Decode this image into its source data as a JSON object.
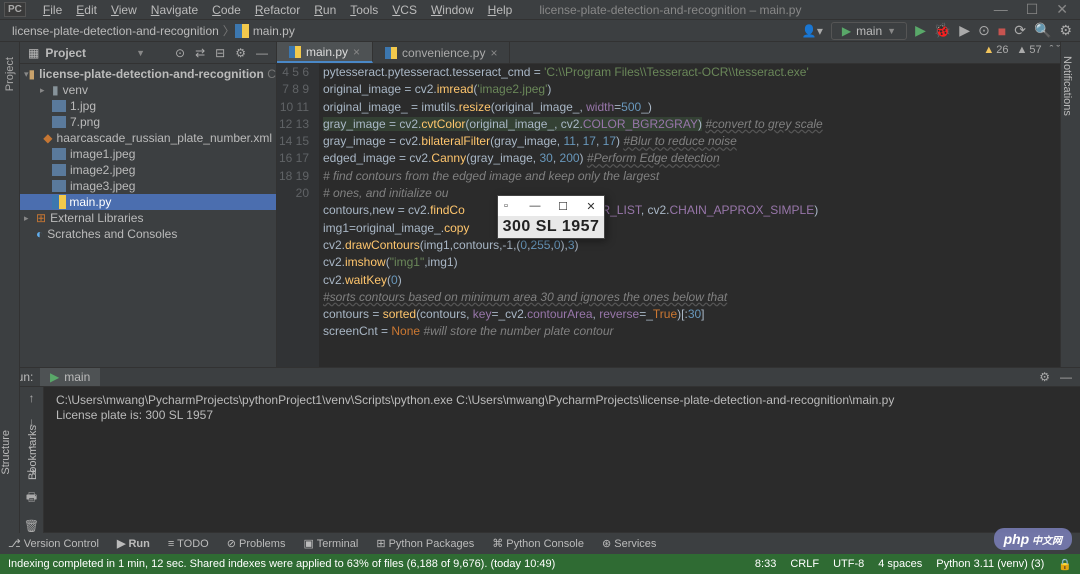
{
  "menu": [
    "File",
    "Edit",
    "View",
    "Navigate",
    "Code",
    "Refactor",
    "Run",
    "Tools",
    "VCS",
    "Window",
    "Help"
  ],
  "window_title": "license-plate-detection-and-recognition – main.py",
  "breadcrumb": {
    "project": "license-plate-detection-and-recognition",
    "file": "main.py"
  },
  "run_config_name": "main",
  "project_panel_title": "Project",
  "tree": {
    "root": "license-plate-detection-and-recognition",
    "root_path": "C:\\Users\\m",
    "items": [
      "venv",
      "1.jpg",
      "7.png",
      "haarcascade_russian_plate_number.xml",
      "image1.jpeg",
      "image2.jpeg",
      "image3.jpeg",
      "main.py"
    ],
    "external": "External Libraries",
    "scratches": "Scratches and Consoles"
  },
  "tabs": {
    "active": "main.py",
    "other": "convenience.py"
  },
  "warnings": {
    "yellow": "26",
    "gray": "57"
  },
  "gutter_start": 4,
  "gutter_end": 20,
  "code_lines": [
    "pytesseract.pytesseract.tesseract_cmd = <str>'C:\\\\Program Files\\\\Tesseract-OCR\\\\tesseract.exe'</str>",
    "original_image = cv2.<fn>imread</fn>(<str>'image2.jpeg'</str>)",
    "original_image_ = imutils.<fn>resize</fn>(original_image_, <prop>width</prop>=<num>500</num>_)",
    "<bg>gray_image = cv2.<fn>cvtColor</fn>(original_image_, cv2.<prop>COLOR_BGR2GRAY</prop>)</bg> <cm-u>#convert to grey scale</cm-u>",
    "gray_image = cv2.<fn>bilateralFilter</fn>(gray_image, <num>11</num>, <num>17</num>, <num>17</num>) <cm-u>#Blur to reduce noise</cm-u>",
    "edged_image = cv2.<fn>Canny</fn>(gray_image, <num>30</num>, <num>200</num>) <cm-u>#Perform Edge detection</cm-u>",
    "<cm># find contours from the edged image and keep only the largest</cm>",
    "<cm># ones, and initialize ou</cm>",
    "contours,new = cv2.<fn>findCo</fn>                 <fn>opy</fn>(), cv2.<prop>RETR_LIST</prop>, cv2.<prop>CHAIN_APPROX_SIMPLE</prop>)",
    "img1=original_image_.<fn>copy</fn>",
    "cv2.<fn>drawContours</fn>(img1,contours,-1,(<num>0</num>,<num>255</num>,<num>0</num>),<num>3</num>)",
    "cv2.<fn>imshow</fn>(<str>\"img1\"</str>,img1)",
    "cv2.<fn>waitKey</fn>(<num>0</num>)",
    "<cm-u>#sorts contours based on minimum area 30 and ignores the ones below that</cm-u>",
    "contours = <fn>sorted</fn>(contours, <prop>key</prop>=_cv2.<prop>contourArea</prop>, <prop>reverse</prop>=_<kw>True</kw>)[:<num>30</num>]",
    "screenCnt = <kw>None</kw> <cm>#will store the number plate contour</cm>"
  ],
  "run_panel": {
    "label": "Run:",
    "tab": "main",
    "output_line1": "C:\\Users\\mwang\\PycharmProjects\\pythonProject1\\venv\\Scripts\\python.exe C:\\Users\\mwang\\PycharmProjects\\license-plate-detection-and-recognition\\main.py",
    "output_line2": "License plate is: 300 SL 1957"
  },
  "popup": {
    "plate": "300 SL 1957"
  },
  "bottom_tools": [
    "Version Control",
    "Run",
    "TODO",
    "Problems",
    "Terminal",
    "Python Packages",
    "Python Console",
    "Services"
  ],
  "status": {
    "left": "Indexing completed in 1 min, 12 sec. Shared indexes were applied to 63% of files (6,188 of 9,676). (today 10:49)",
    "pos": "8:33",
    "sep": "CRLF",
    "enc": "UTF-8",
    "indent": "4 spaces",
    "python": "Python 3.11 (venv) (3)"
  },
  "side_tabs": {
    "left_top": "Project",
    "left_mid": "Bookmarks",
    "left_mid2": "Structure",
    "right": "Notifications"
  },
  "php_watermark": "php"
}
